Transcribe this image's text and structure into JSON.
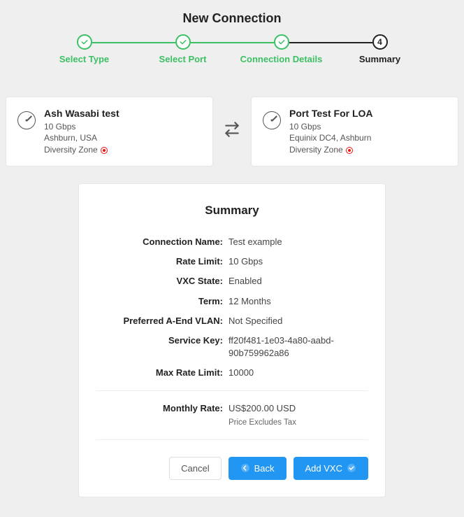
{
  "page_title": "New Connection",
  "steps": [
    {
      "label": "Select Type",
      "state": "done"
    },
    {
      "label": "Select Port",
      "state": "done"
    },
    {
      "label": "Connection Details",
      "state": "done"
    },
    {
      "label": "Summary",
      "state": "current",
      "num": "4"
    }
  ],
  "source_port": {
    "name": "Ash Wasabi test",
    "speed": "10 Gbps",
    "location": "Ashburn, USA",
    "diversity_label": "Diversity Zone"
  },
  "dest_port": {
    "name": "Port Test For LOA",
    "speed": "10 Gbps",
    "location": "Equinix DC4, Ashburn",
    "diversity_label": "Diversity Zone"
  },
  "summary": {
    "heading": "Summary",
    "labels": {
      "connection_name": "Connection Name:",
      "rate_limit": "Rate Limit:",
      "vxc_state": "VXC State:",
      "term": "Term:",
      "preferred_vlan": "Preferred A-End VLAN:",
      "service_key": "Service Key:",
      "max_rate_limit": "Max Rate Limit:",
      "monthly_rate": "Monthly Rate:"
    },
    "values": {
      "connection_name": "Test example",
      "rate_limit": "10 Gbps",
      "vxc_state": "Enabled",
      "term": "12 Months",
      "preferred_vlan": "Not Specified",
      "service_key": "ff20f481-1e03-4a80-aabd-90b759962a86",
      "max_rate_limit": "10000",
      "monthly_rate": "US$200.00 USD",
      "rate_note": "Price Excludes Tax"
    }
  },
  "actions": {
    "cancel": "Cancel",
    "back": "Back",
    "add_vxc": "Add VXC"
  }
}
